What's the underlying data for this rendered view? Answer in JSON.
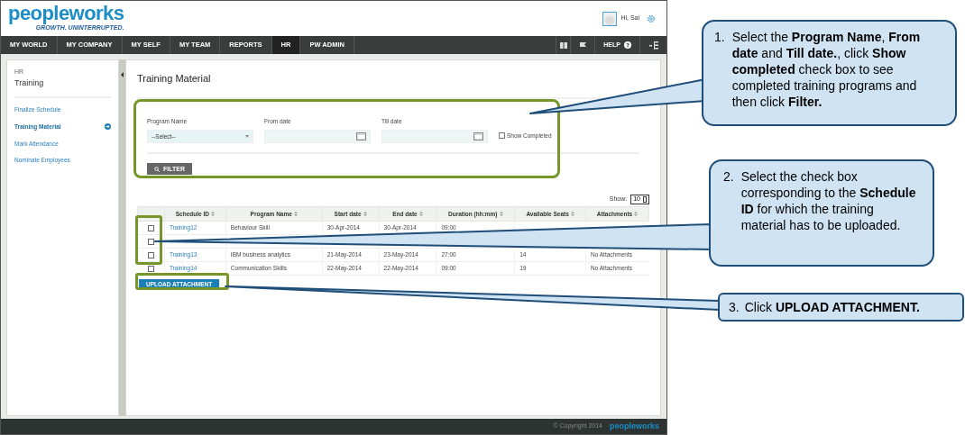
{
  "header": {
    "logo": "peopleworks",
    "tagline": "GROWTH. UNINTERRUPTED.",
    "greeting": "Hi, Sai"
  },
  "nav": [
    {
      "label": "MY WORLD",
      "selected": false
    },
    {
      "label": "MY COMPANY",
      "selected": false
    },
    {
      "label": "MY SELF",
      "selected": false
    },
    {
      "label": "MY TEAM",
      "selected": false
    },
    {
      "label": "REPORTS",
      "selected": false
    },
    {
      "label": "HR",
      "selected": true
    },
    {
      "label": "PW ADMIN",
      "selected": false
    }
  ],
  "help": "HELP",
  "sidebar": {
    "section": "HR",
    "title": "Training",
    "items": [
      {
        "label": "Finalize Schedule",
        "selected": false
      },
      {
        "label": "Training Material",
        "selected": true
      },
      {
        "label": "Mark Attendance",
        "selected": false
      },
      {
        "label": "Nominate Employees",
        "selected": false
      }
    ]
  },
  "page_title": "Training Material",
  "filter": {
    "fields": [
      {
        "kind": "select",
        "label": "Program Name",
        "value": "--Select--"
      },
      {
        "kind": "date",
        "label": "From date"
      },
      {
        "kind": "date",
        "label": "Till date"
      }
    ],
    "show_completed": {
      "label": "Show Completed",
      "checked": false
    },
    "button": "FILTER"
  },
  "table": {
    "show_label": "Show:",
    "page_size": "10",
    "columns": [
      "Schedule ID",
      "Program Name",
      "Start date",
      "End date",
      "Duration (hh:mm)",
      "Available Seats",
      "Attachments"
    ],
    "rows": [
      {
        "selected": false,
        "cells": [
          "Training12",
          "Behaviour Skill",
          "30-Apr-2014",
          "30-Apr-2014",
          "09:00"
        ]
      },
      {
        "selected": false
      },
      {
        "selected": false,
        "cells": [
          "Training13",
          "IBM business analytics",
          "21-May-2014",
          "23-May-2014",
          "27:00",
          "14",
          "No Attachments"
        ]
      },
      {
        "selected": false,
        "cells": [
          "Training14",
          "Communication Skills",
          "22-May-2014",
          "22-May-2014",
          "09:00",
          "19",
          "No Attachments"
        ]
      }
    ]
  },
  "upload_button": "UPLOAD ATTACHMENT",
  "footer": {
    "copyright": "© Copyright 2014",
    "logo": "peopleworks"
  },
  "callouts": [
    {
      "number": "1.",
      "text": "Select the **Program Name**, **From date** and **Till date.**, click **Show completed** check box to see completed training programs and then click **Filter.**"
    },
    {
      "number": "2.",
      "text": "Select the check box corresponding to the **Schedule ID** for which the training material has to be uploaded."
    },
    {
      "number": "3.",
      "text": "Click **UPLOAD ATTACHMENT.**"
    }
  ]
}
